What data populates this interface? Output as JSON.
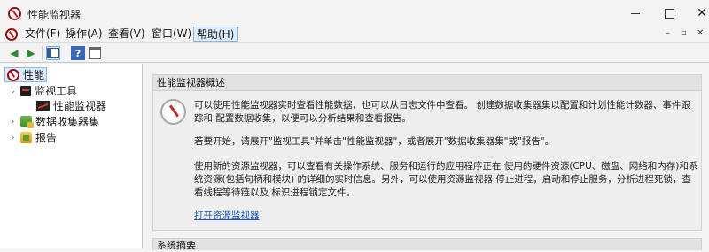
{
  "window": {
    "title": "性能监视器"
  },
  "menu": {
    "items": [
      "文件(F)",
      "操作(A)",
      "查看(V)",
      "窗口(W)",
      "帮助(H)"
    ],
    "active": "帮助(H)"
  },
  "toolbar": {
    "back": "back-arrow-icon",
    "forward": "forward-arrow-icon",
    "show_hide": "show-hide-console-tree-icon",
    "help": "?",
    "properties": "properties-icon"
  },
  "tree": {
    "root": "性能",
    "monitoring_tools": "监视工具",
    "performance_monitor": "性能监视器",
    "data_collector_sets": "数据收集器集",
    "reports": "报告"
  },
  "overview": {
    "header": "性能监视器概述",
    "p1": "可以使用性能监视器实时查看性能数据，也可以从日志文件中查看。 创建数据收集器集以配置和计划性能计数器、事件跟踪和 配置数据收集，以便可以分析结果和查看报告。",
    "p2": "若要开始，请展开\"监视工具\"并单击\"性能监视器\"，或者展开\"数据收集器集\"或\"报告\"。",
    "p3": "使用新的资源监视器，可以查看有关操作系统、服务和运行的应用程序正在 使用的硬件资源(CPU、磁盘、网络和内存)和系统资源(包括句柄和模块) 的详细的实时信息。另外，可以使用资源监视器 停止进程，启动和停止服务，分析进程死锁，查看线程等待链以及 标识进程锁定文件。",
    "link": "打开资源监视器"
  },
  "summary": {
    "header": "系统摘要"
  },
  "colors": {
    "accent": "#dcebfb",
    "link": "#1a56b8",
    "background": "#f3f3f3"
  }
}
